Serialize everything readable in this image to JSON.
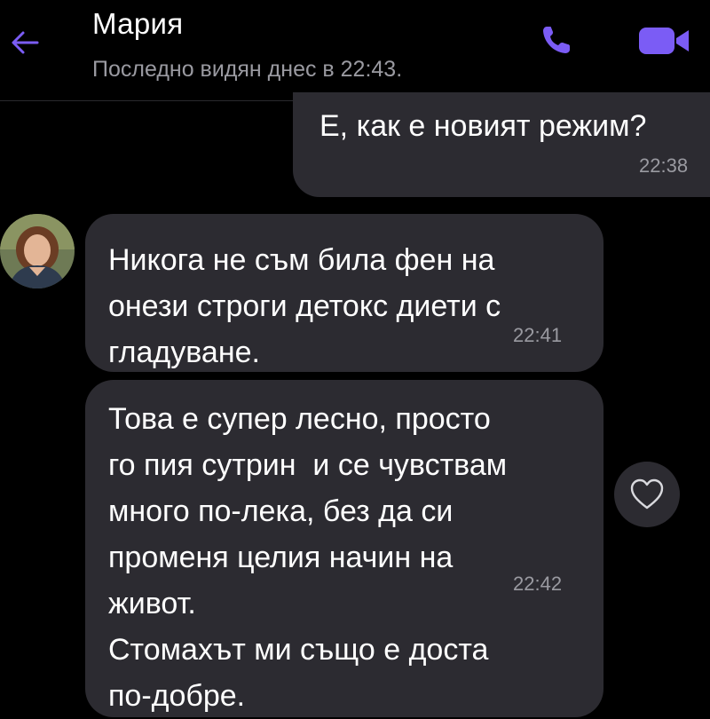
{
  "header": {
    "contact_name": "Мария",
    "last_seen": "Последно видян днес в 22:43.",
    "accent_color": "#7b5cf5"
  },
  "icons": {
    "back": "arrow-left-icon",
    "call": "phone-icon",
    "video": "video-camera-icon",
    "avatar": "contact-avatar",
    "like": "heart-icon"
  },
  "messages": [
    {
      "direction": "outgoing",
      "text": "Е, как е новият режим?",
      "time": "22:38"
    },
    {
      "direction": "incoming",
      "text": "Никога не съм била фен на\nонези строги детокс диети с\nгладуване.",
      "time": "22:41"
    },
    {
      "direction": "incoming",
      "text": "Това е супер лесно, просто\nго пия сутрин  и се чувствам\nмного по-лека, без да си\nпроменя целия начин на\nживот.\nСтомахът ми също е доста\nпо-добре.",
      "time": "22:42"
    }
  ]
}
